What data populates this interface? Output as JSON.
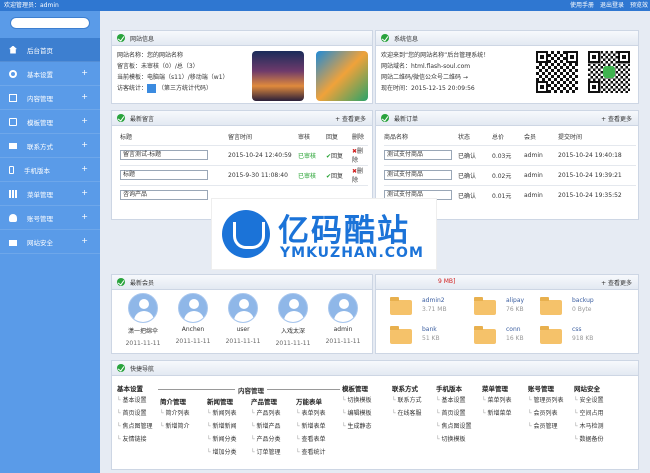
{
  "topbar": {
    "welcome": "欢迎管理员：admin",
    "links": [
      "使用手册",
      "退出登录",
      "预览效"
    ]
  },
  "sidebar": {
    "items": [
      {
        "label": "后台首页",
        "icon": "home-icon",
        "active": true
      },
      {
        "label": "基本设置",
        "icon": "gear-icon"
      },
      {
        "label": "内容管理",
        "icon": "document-icon"
      },
      {
        "label": "模板管理",
        "icon": "template-icon"
      },
      {
        "label": "联系方式",
        "icon": "mail-icon"
      },
      {
        "label": "手机版本",
        "icon": "mobile-icon"
      },
      {
        "label": "菜单管理",
        "icon": "grid-icon"
      },
      {
        "label": "账号管理",
        "icon": "user-icon"
      },
      {
        "label": "网站安全",
        "icon": "lock-icon"
      }
    ]
  },
  "site_info": {
    "title": "网站信息",
    "name": "网站名称：您的网站名称",
    "unread": "留言板：未审核（0）/总（3）",
    "template": "当前模板：电脑端（s11）/移动端（w1）",
    "stats": "访客统计：",
    "stats_link": "（第三方统计代码）"
  },
  "sys_info": {
    "title": "系统信息",
    "welcome": "欢迎来到“您的网站名称”后台管理系统！",
    "domain": "网站域名：html.flash-soul.com",
    "qrcode": "网站二维码/微信公众号二维码 →",
    "time": "现在时间：2015-12-15 20:09:56"
  },
  "messages": {
    "title": "最新留言",
    "more": "+ 查看更多",
    "headers": [
      "标题",
      "留言时间",
      "审核",
      "回复",
      "删除"
    ],
    "rows": [
      {
        "title": "留言测试-标题",
        "time": "2015-10-24 12:40:59",
        "status": "已审核",
        "reply": "回复",
        "del": "删除"
      },
      {
        "title": "标题",
        "time": "2015-9-30 11:08:40",
        "status": "已审核",
        "reply": "回复",
        "del": "删除"
      },
      {
        "title": "咨询产品",
        "time": "",
        "status": "",
        "reply": "",
        "del": ""
      }
    ]
  },
  "orders": {
    "title": "最新订单",
    "more": "+ 查看更多",
    "headers": [
      "商品名称",
      "状态",
      "总价",
      "会员",
      "提交时间"
    ],
    "rows": [
      {
        "name": "测试支付商品",
        "status": "已确认",
        "price": "0.03元",
        "member": "admin",
        "time": "2015-10-24 19:40:18"
      },
      {
        "name": "测试支付商品",
        "status": "已确认",
        "price": "0.02元",
        "member": "admin",
        "time": "2015-10-24 19:39:21"
      },
      {
        "name": "测试支付商品",
        "status": "已确认",
        "price": "0.01元",
        "member": "admin",
        "time": "2015-10-24 19:35:52"
      }
    ]
  },
  "members": {
    "title": "最新会员",
    "items": [
      {
        "name": "潇一把绵伞",
        "date": "2011-11-11"
      },
      {
        "name": "Anchen",
        "date": "2011-11-11"
      },
      {
        "name": "user",
        "date": "2011-11-11"
      },
      {
        "name": "入戏太深",
        "date": "2011-11-11"
      },
      {
        "name": "admin",
        "date": "2011-11-11"
      }
    ]
  },
  "files": {
    "size_label": "9 MB]",
    "more": "+ 查看更多",
    "items": [
      {
        "name": "admin2",
        "size": "3.71 MB"
      },
      {
        "name": "alipay",
        "size": "76 KB"
      },
      {
        "name": "backup",
        "size": "0 Byte"
      },
      {
        "name": "bank",
        "size": "51 KB"
      },
      {
        "name": "conn",
        "size": "16 KB"
      },
      {
        "name": "css",
        "size": "918 KB"
      }
    ]
  },
  "quicknav": {
    "title": "快捷导航",
    "group_content": "内容管理",
    "cols": [
      {
        "h": "基本设置",
        "items": [
          "基本设置",
          "首页设置",
          "焦点图管理",
          "友情链接"
        ]
      },
      {
        "h": "简介管理",
        "items": [
          "简介列表",
          "新增简介"
        ]
      },
      {
        "h": "新闻管理",
        "items": [
          "新闻列表",
          "新增新闻",
          "新闻分类",
          "增加分类"
        ]
      },
      {
        "h": "产品管理",
        "items": [
          "产品列表",
          "新增产品",
          "产品分类",
          "订单管理"
        ]
      },
      {
        "h": "万能表单",
        "items": [
          "表单列表",
          "新增表单",
          "查看表单",
          "查看统计"
        ]
      },
      {
        "h": "模板管理",
        "items": [
          "切换模板",
          "编辑模板",
          "生成静态"
        ]
      },
      {
        "h": "联系方式",
        "items": [
          "联系方式",
          "在线客服"
        ]
      },
      {
        "h": "手机版本",
        "items": [
          "基本设置",
          "首页设置",
          "焦点图设置",
          "切换模板"
        ]
      },
      {
        "h": "菜单管理",
        "items": [
          "菜单列表",
          "新增菜单"
        ]
      },
      {
        "h": "账号管理",
        "items": [
          "管理员列表",
          "会员列表",
          "会员管理"
        ]
      },
      {
        "h": "网站安全",
        "items": [
          "安全设置",
          "空间占用",
          "木马检测",
          "数据备份"
        ]
      }
    ]
  },
  "watermark": {
    "cn": "亿码酷站",
    "en": "YMKUZHAN.COM"
  },
  "colors": {
    "topbar": "#2f77d1",
    "sidebar": "#5a9be8",
    "accent": "#1b73d8",
    "approved": "#22a12f"
  }
}
